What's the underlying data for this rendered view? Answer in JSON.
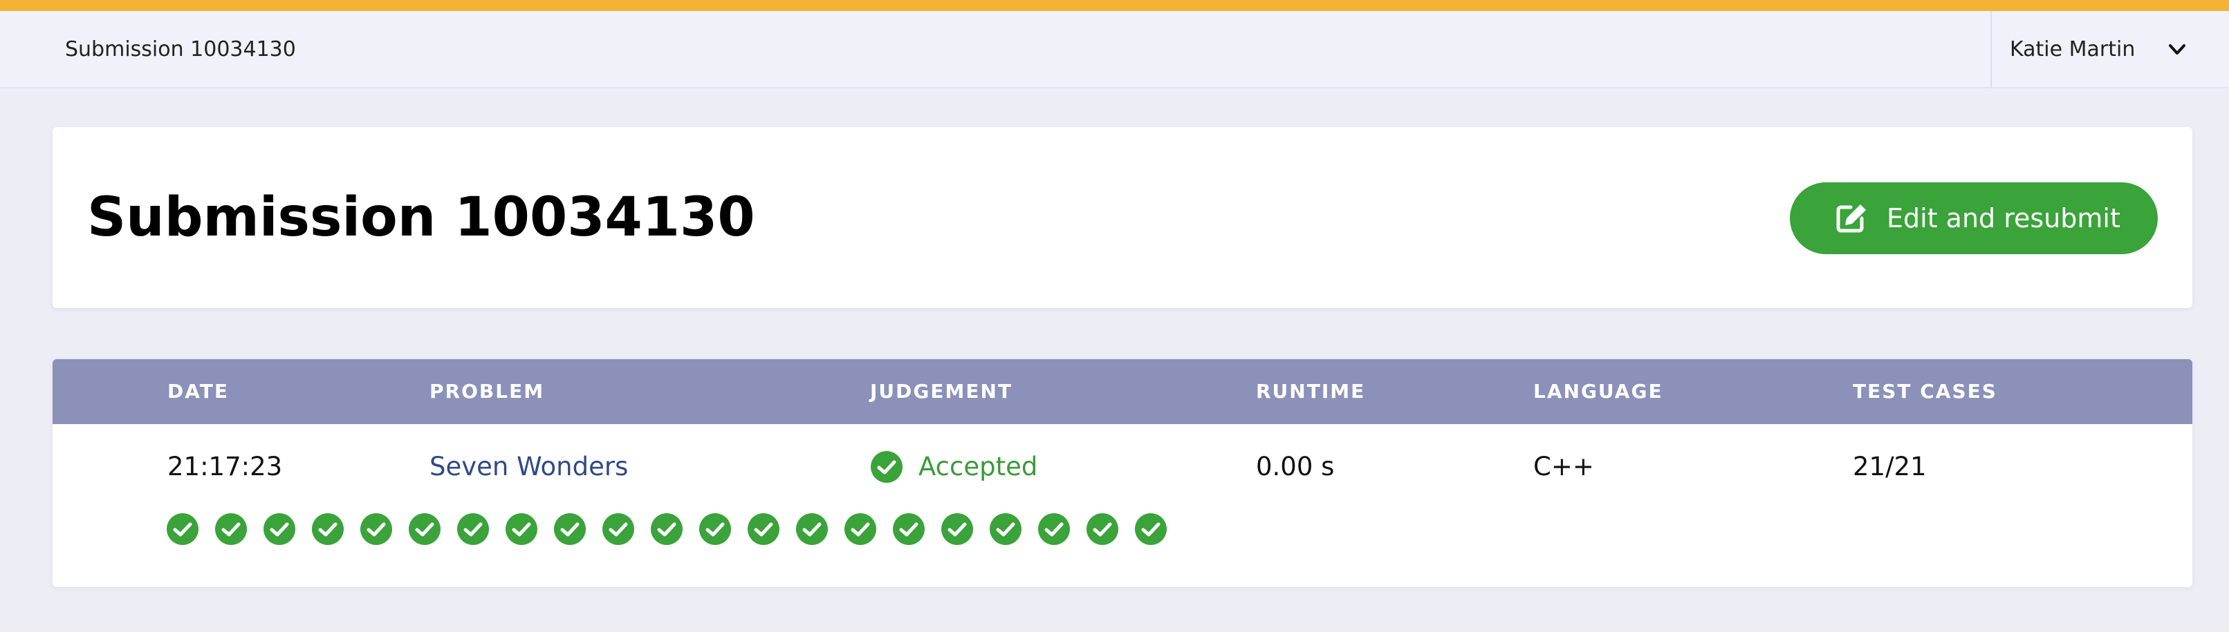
{
  "topbar": {
    "title": "Submission 10034130",
    "user_name": "Katie Martin"
  },
  "header": {
    "title": "Submission 10034130",
    "resubmit_label": "Edit and resubmit"
  },
  "table": {
    "columns": [
      "DATE",
      "PROBLEM",
      "JUDGEMENT",
      "RUNTIME",
      "LANGUAGE",
      "TEST CASES"
    ],
    "row": {
      "date": "21:17:23",
      "problem": "Seven Wonders",
      "judgement": "Accepted",
      "runtime": "0.00 s",
      "language": "C++",
      "test_cases": "21/21"
    },
    "test_case_results": [
      "passed",
      "passed",
      "passed",
      "passed",
      "passed",
      "passed",
      "passed",
      "passed",
      "passed",
      "passed",
      "passed",
      "passed",
      "passed",
      "passed",
      "passed",
      "passed",
      "passed",
      "passed",
      "passed",
      "passed",
      "passed"
    ]
  },
  "icons": {
    "user_menu": "chevron-down-icon",
    "resubmit": "edit-icon",
    "judgement": "check-circle-icon",
    "test_case": "check-circle-icon"
  },
  "colors": {
    "accent_stripe": "#f4b334",
    "success": "#3aa33a",
    "table_header": "#8b91b8",
    "link": "#2e4a88"
  }
}
